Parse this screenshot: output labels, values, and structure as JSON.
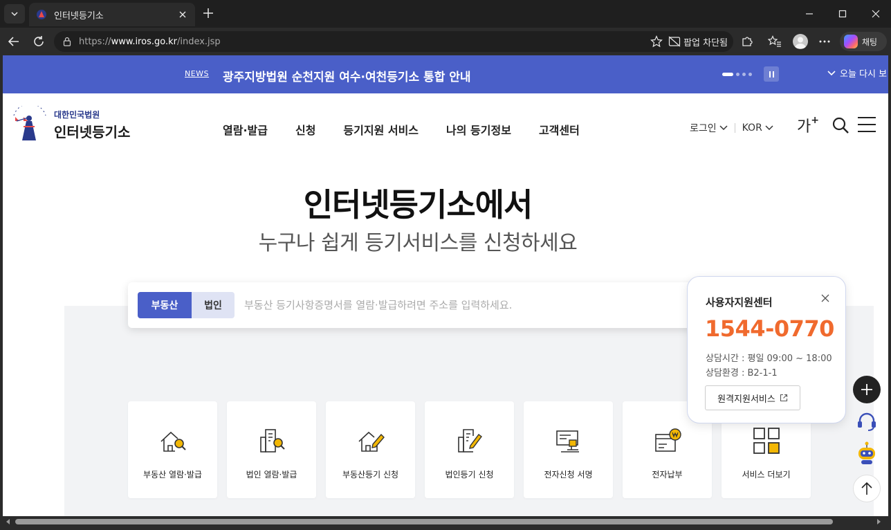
{
  "browser": {
    "tab_title": "인터넷등기소",
    "url_prefix": "https://",
    "url_host": "www.iros.go.kr",
    "url_path": "/index.jsp",
    "popup_blocked_label": "팝업 차단됨",
    "copilot_label": "채팅"
  },
  "notice": {
    "tag": "NEWS",
    "text": "광주지방법원 순천지원 여수·여천등기소 통합 안내",
    "today_close": "오늘 다시 보"
  },
  "header": {
    "logo_sub": "대한민국법원",
    "logo_main": "인터넷등기소",
    "nav": [
      "열람·발급",
      "신청",
      "등기지원 서비스",
      "나의 등기정보",
      "고객센터"
    ],
    "login": "로그인",
    "language": "KOR",
    "font_size_label": "가",
    "font_size_sup": "+"
  },
  "hero": {
    "title": "인터넷등기소에서",
    "subtitle": "누구나 쉽게 등기서비스를 신청하세요"
  },
  "search": {
    "tab_real_estate": "부동산",
    "tab_corporation": "법인",
    "placeholder": "부동산 등기사항증명서를 열람·발급하려면 주소를 입력하세요."
  },
  "quick_menu": [
    {
      "label": "부동산 열람·발급",
      "icon": "house-search-icon"
    },
    {
      "label": "법인 열람·발급",
      "icon": "building-search-icon"
    },
    {
      "label": "부동산등기 신청",
      "icon": "house-pen-icon"
    },
    {
      "label": "법인등기 신청",
      "icon": "building-pen-icon"
    },
    {
      "label": "전자신청 서명",
      "icon": "e-sign-icon"
    },
    {
      "label": "전자납부",
      "icon": "e-payment-icon"
    },
    {
      "label": "서비스 더보기",
      "icon": "grid-more-icon"
    }
  ],
  "support": {
    "title": "사용자지원센터",
    "phone": "1544-0770",
    "hours": "상담시간 : 평일 09:00 ~ 18:00",
    "env": "상담환경 : B2-1-1",
    "remote_label": "원격지원서비스"
  },
  "colors": {
    "brand_blue": "#4a5fc8",
    "phone_orange": "#f06a2e",
    "gold": "#f2b705"
  }
}
